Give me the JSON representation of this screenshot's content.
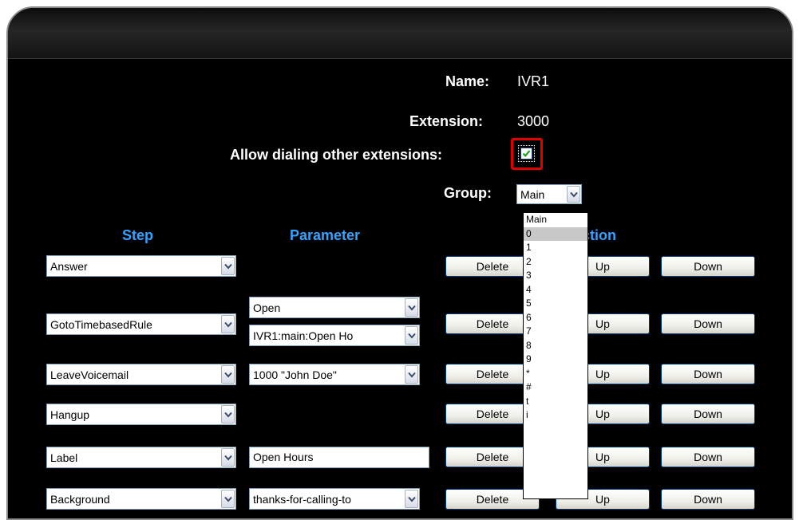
{
  "form": {
    "name_label": "Name:",
    "name_value": "IVR1",
    "extension_label": "Extension:",
    "extension_value": "3000",
    "allow_label": "Allow dialing other extensions:",
    "allow_checked": true,
    "group_label": "Group:",
    "group_value": "Main"
  },
  "group_dropdown": {
    "options": [
      "Main",
      "0",
      "1",
      "2",
      "3",
      "4",
      "5",
      "6",
      "7",
      "8",
      "9",
      "*",
      "#",
      "t",
      "i"
    ],
    "highlighted": "0"
  },
  "columns": {
    "step": "Step",
    "parameter": "Parameter",
    "action": "Action"
  },
  "buttons": {
    "delete": "Delete",
    "up": "Up",
    "down": "Down"
  },
  "rows": [
    {
      "step": "Answer",
      "params": []
    },
    {
      "step": "GotoTimebasedRule",
      "params": [
        {
          "type": "select",
          "value": "Open"
        },
        {
          "type": "select",
          "value": "IVR1:main:Open Ho"
        }
      ]
    },
    {
      "step": "LeaveVoicemail",
      "params": [
        {
          "type": "select",
          "value": "1000 \"John Doe\""
        }
      ]
    },
    {
      "step": "Hangup",
      "params": []
    },
    {
      "step": "Label",
      "params": [
        {
          "type": "text",
          "value": "Open Hours"
        }
      ]
    },
    {
      "step": "Background",
      "params": [
        {
          "type": "select",
          "value": "thanks-for-calling-to"
        }
      ]
    }
  ],
  "colors": {
    "background": "#000000",
    "column_header": "#33a3ff",
    "highlight_border": "#e00000"
  }
}
